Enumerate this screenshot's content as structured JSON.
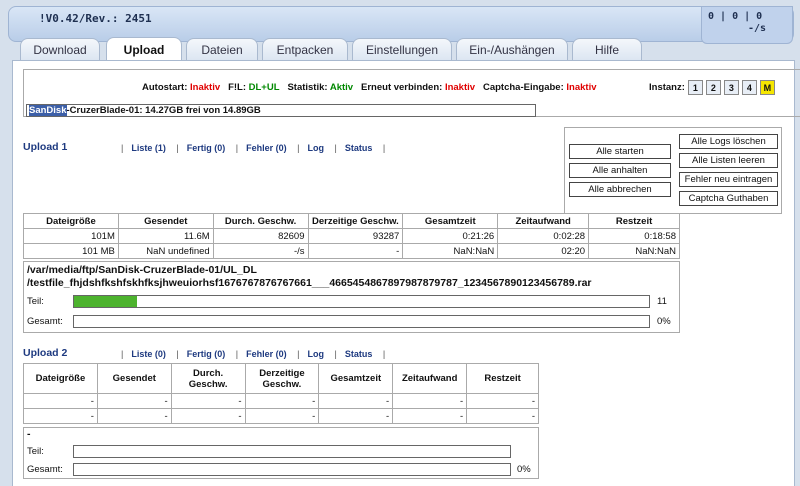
{
  "header": {
    "version": "!V0.42/Rev.: 2451",
    "counts": "0 | 0 | 0",
    "speed": "-/s"
  },
  "tabs": [
    "Download",
    "Upload",
    "Dateien",
    "Entpacken",
    "Einstellungen",
    "Ein-/Aushängen",
    "Hilfe"
  ],
  "status": {
    "autostart_label": "Autostart:",
    "autostart_value": "Inaktiv",
    "fl_label": "F!L:",
    "fl_value": "DL+UL",
    "statistik_label": "Statistik:",
    "statistik_value": "Aktiv",
    "reconnect_label": "Erneut verbinden:",
    "reconnect_value": "Inaktiv",
    "captcha_label": "Captcha-Eingabe:",
    "captcha_value": "Inaktiv",
    "instanz_label": "Instanz:",
    "instanz": [
      "1",
      "2",
      "3",
      "4",
      "M"
    ],
    "disk_name": "SanDisk",
    "disk_rest": "-CruzerBlade-01: 14.27GB frei von 14.89GB"
  },
  "controls": {
    "start_all": "Alle starten",
    "stop_all": "Alle anhalten",
    "cancel_all": "Alle abbrechen",
    "clear_logs": "Alle Logs löschen",
    "clear_lists": "Alle Listen leeren",
    "re_enter_errors": "Fehler neu eintragen",
    "captcha_credit": "Captcha Guthaben"
  },
  "upload1": {
    "title": "Upload 1",
    "links": [
      "Liste (1)",
      "Fertig (0)",
      "Fehler (0)",
      "Log",
      "Status"
    ],
    "columns": [
      "Dateigröße",
      "Gesendet",
      "Durch. Geschw.",
      "Derzeitige Geschw.",
      "Gesamtzeit",
      "Zeitaufwand",
      "Restzeit"
    ],
    "rows": [
      [
        "101M",
        "11.6M",
        "82609",
        "93287",
        "0:21:26",
        "0:02:28",
        "0:18:58"
      ],
      [
        "101 MB",
        "NaN undefined",
        "-/s",
        "-",
        "NaN:NaN",
        "02:20",
        "NaN:NaN"
      ]
    ],
    "file_line1": "/var/media/ftp/SanDisk-CruzerBlade-01/UL_DL",
    "file_line2": "/testfile_fhjdshfkshfskhfksjhweuiorhsf1676767876767661___4665454867897987879787_1234567890123456789.rar",
    "teil_label": "Teil:",
    "teil_value": "11",
    "teil_fraction": 0.11,
    "gesamt_label": "Gesamt:",
    "gesamt_value": "0%",
    "gesamt_fraction": 0
  },
  "upload2": {
    "title": "Upload 2",
    "links": [
      "Liste (0)",
      "Fertig (0)",
      "Fehler (0)",
      "Log",
      "Status"
    ],
    "columns": [
      "Dateigröße",
      "Gesendet",
      "Durch. Geschw.",
      "Derzeitige Geschw.",
      "Gesamtzeit",
      "Zeitaufwand",
      "Restzeit"
    ],
    "rows": [
      [
        "-",
        "-",
        "-",
        "-",
        "-",
        "-",
        "-"
      ],
      [
        "-",
        "-",
        "-",
        "-",
        "-",
        "-",
        "-"
      ]
    ],
    "file_line1": "-",
    "teil_label": "Teil:",
    "teil_value": "",
    "gesamt_label": "Gesamt:",
    "gesamt_value": "0%"
  }
}
